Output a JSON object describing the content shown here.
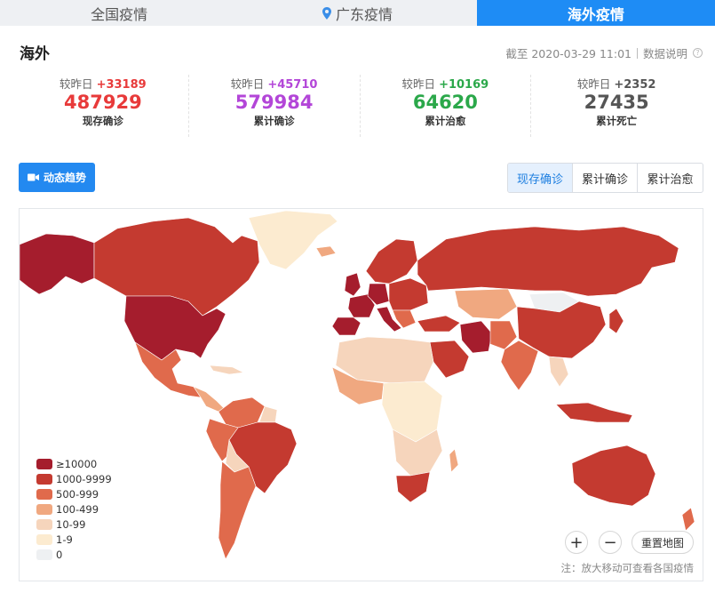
{
  "tabs": [
    {
      "label": "全国疫情"
    },
    {
      "label": "广东疫情"
    },
    {
      "label": "海外疫情"
    }
  ],
  "header": {
    "title": "海外",
    "asof": "截至 2020-03-29 11:01",
    "data_note": "数据说明"
  },
  "stats": [
    {
      "delta_label": "较昨日",
      "delta": "+33189",
      "value": "487929",
      "label": "现存确诊",
      "color": "#e83a3a"
    },
    {
      "delta_label": "较昨日",
      "delta": "+45710",
      "value": "579984",
      "label": "累计确诊",
      "color": "#b346d8"
    },
    {
      "delta_label": "较昨日",
      "delta": "+10169",
      "value": "64620",
      "label": "累计治愈",
      "color": "#2ba84a"
    },
    {
      "delta_label": "较昨日",
      "delta": "+2352",
      "value": "27435",
      "label": "累计死亡",
      "color": "#555555"
    }
  ],
  "trend_button": {
    "label": "动态趋势"
  },
  "map_tabs": [
    {
      "label": "现存确诊",
      "active": true
    },
    {
      "label": "累计确诊",
      "active": false
    },
    {
      "label": "累计治愈",
      "active": false
    }
  ],
  "legend": [
    {
      "label": "≥10000",
      "color": "#a51d2d"
    },
    {
      "label": "1000-9999",
      "color": "#c43a30"
    },
    {
      "label": "500-999",
      "color": "#e06a4c"
    },
    {
      "label": "100-499",
      "color": "#f0a880"
    },
    {
      "label": "10-99",
      "color": "#f6d5bc"
    },
    {
      "label": "1-9",
      "color": "#fcebd0"
    },
    {
      "label": "0",
      "color": "#eef0f2"
    }
  ],
  "map_controls": {
    "zoom_in": "+",
    "zoom_out": "−",
    "reset": "重置地图"
  },
  "map_note": "注：放大移动可查看各国疫情"
}
